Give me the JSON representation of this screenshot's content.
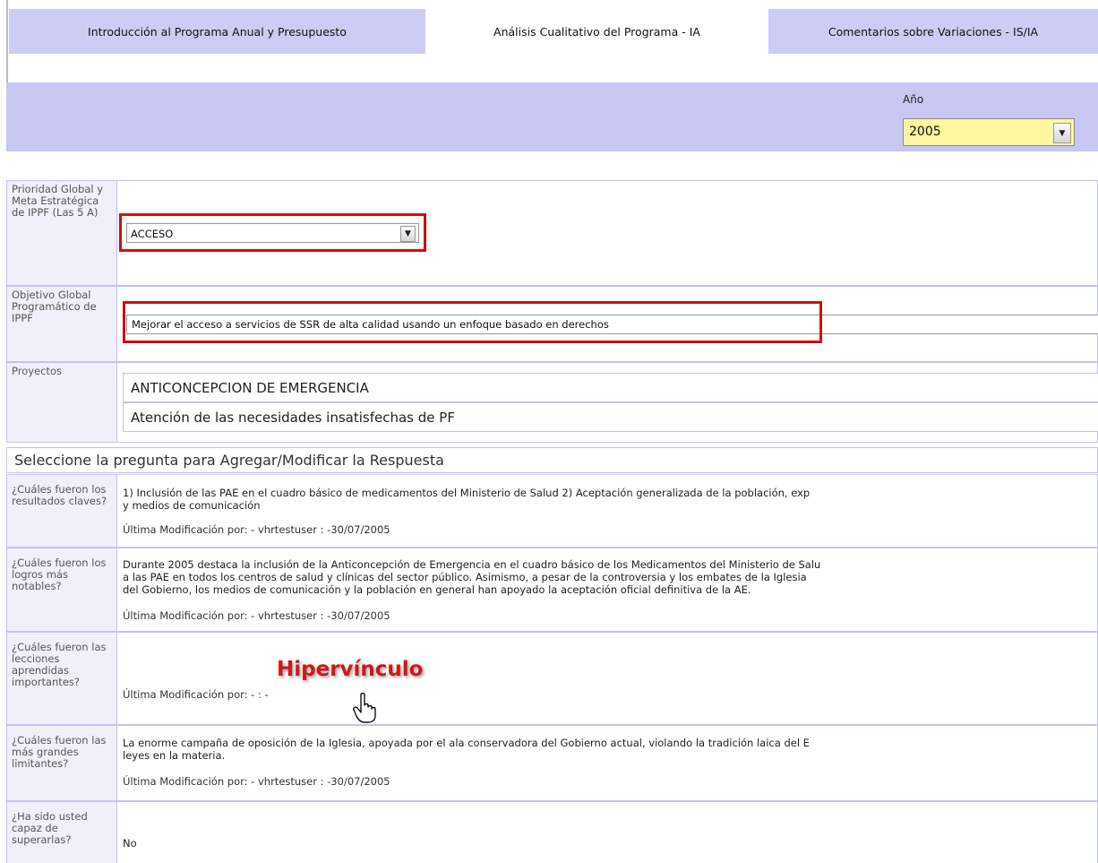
{
  "tabs": [
    {
      "label": "Introducción al Programa Anual y Presupuesto",
      "active": false
    },
    {
      "label": "Análisis Cualitativo del Programa - IA",
      "active": true
    },
    {
      "label": "Comentarios sobre Variaciones - IS/IA",
      "active": false
    }
  ],
  "year": {
    "label": "Año",
    "value": "2005"
  },
  "fields": {
    "priority": {
      "label": "Prioridad Global y Meta Estratégica de IPPF (Las 5 A)",
      "value": "ACCESO"
    },
    "objective": {
      "label": "Objetivo Global Programático de IPPF",
      "value": "Mejorar el acceso a servicios de SSR de alta calidad usando un enfoque basado en derechos"
    },
    "projects": {
      "label": "Proyectos",
      "items": [
        "ANTICONCEPCION DE EMERGENCIA",
        "Atención de las necesidades insatisfechas de PF"
      ]
    }
  },
  "section_title": "Seleccione la pregunta para Agregar/Modificar la Respuesta",
  "questions": [
    {
      "question": "¿Cuáles fueron los resultados claves?",
      "answer_lines": [
        "1) Inclusión de las PAE en el cuadro básico de medicamentos del Ministerio de Salud 2) Aceptación generalizada de la población, exp",
        "y medios de comunicación"
      ],
      "meta": "Última Modificación por: - vhrtestuser : -30/07/2005"
    },
    {
      "question": "¿Cuáles fueron los logros más notables?",
      "answer_lines": [
        "Durante 2005 destaca la inclusión de la Anticoncepción de Emergencia en el cuadro básico de los Medicamentos del Ministerio de Salu",
        "a las PAE en todos los centros de salud y clínicas del sector público. Asimismo, a pesar de la controversia y los embates de la Iglesia",
        "del Gobierno, los medios de comunicación y la población en general han apoyado la aceptación oficial definitiva de la AE."
      ],
      "meta": "Última Modificación por: - vhrtestuser : -30/07/2005"
    },
    {
      "question": "¿Cuáles fueron las lecciones aprendidas importantes?",
      "answer_lines": [],
      "meta": "Última Modificación por: - : -"
    },
    {
      "question": "¿Cuáles fueron las más grandes limitantes?",
      "answer_lines": [
        "La enorme campaña de oposición de la Iglesia, apoyada por el ala conservadora del Gobierno actual, violando la tradición laica del E",
        "leyes en la materia."
      ],
      "meta": "Última Modificación por: - vhrtestuser : -30/07/2005"
    },
    {
      "question": "¿Ha sido usted capaz de superarlas?",
      "answer_lines": [
        "No"
      ],
      "meta": ""
    }
  ],
  "annotation": "Hipervínculo",
  "colors": {
    "tab_bg": "#ccccf4",
    "band_bg": "#c7c7f2",
    "highlight_red": "#cc1010",
    "year_select_bg": "#fff6a0"
  }
}
